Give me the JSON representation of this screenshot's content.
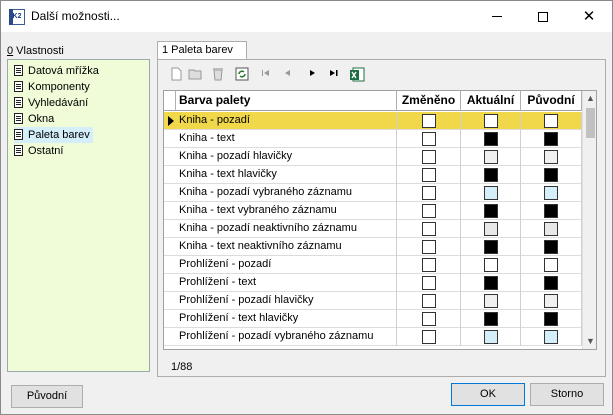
{
  "window": {
    "title": "Další možnosti...",
    "app_icon_text": "K2"
  },
  "left": {
    "label_prefix": "0",
    "label_rest": " Vlastnosti",
    "items": [
      {
        "label": "Datová mřížka",
        "selected": false
      },
      {
        "label": "Komponenty",
        "selected": false
      },
      {
        "label": "Vyhledávání",
        "selected": false
      },
      {
        "label": "Okna",
        "selected": false
      },
      {
        "label": "Paleta barev",
        "selected": true
      },
      {
        "label": "Ostatní",
        "selected": false
      }
    ]
  },
  "tab": {
    "label": "1 Paleta barev"
  },
  "toolbar": {
    "icons": [
      "new-icon",
      "open-icon",
      "delete-icon",
      "refresh-icon",
      "first-icon",
      "prev-icon",
      "next-icon",
      "last-icon",
      "excel-icon"
    ]
  },
  "grid": {
    "headers": {
      "name": "Barva palety",
      "changed": "Změněno",
      "current": "Aktuální",
      "original": "Původní"
    },
    "rows": [
      {
        "name": "Kniha - pozadí",
        "changed": "#ffffff",
        "current": "#ffffff",
        "original": "#ffffff",
        "current_row": true
      },
      {
        "name": "Kniha - text",
        "changed": "#ffffff",
        "current": "#000000",
        "original": "#000000"
      },
      {
        "name": "Kniha - pozadí hlavičky",
        "changed": "#ffffff",
        "current": "#f0f0f0",
        "original": "#f0f0f0"
      },
      {
        "name": "Kniha - text hlavičky",
        "changed": "#ffffff",
        "current": "#000000",
        "original": "#000000"
      },
      {
        "name": "Kniha - pozadí vybraného záznamu",
        "changed": "#ffffff",
        "current": "#d4eefa",
        "original": "#d4eefa"
      },
      {
        "name": "Kniha - text vybraného záznamu",
        "changed": "#ffffff",
        "current": "#000000",
        "original": "#000000"
      },
      {
        "name": "Kniha - pozadí neaktivního záznamu",
        "changed": "#ffffff",
        "current": "#e8e8e8",
        "original": "#e8e8e8"
      },
      {
        "name": "Kniha - text neaktivního záznamu",
        "changed": "#ffffff",
        "current": "#000000",
        "original": "#000000"
      },
      {
        "name": "Prohlížení - pozadí",
        "changed": "#ffffff",
        "current": "#ffffff",
        "original": "#ffffff"
      },
      {
        "name": "Prohlížení - text",
        "changed": "#ffffff",
        "current": "#000000",
        "original": "#000000"
      },
      {
        "name": "Prohlížení - pozadí hlavičky",
        "changed": "#ffffff",
        "current": "#f0f0f0",
        "original": "#f0f0f0"
      },
      {
        "name": "Prohlížení - text hlavičky",
        "changed": "#ffffff",
        "current": "#000000",
        "original": "#000000"
      },
      {
        "name": "Prohlížení - pozadí vybraného záznamu",
        "changed": "#ffffff",
        "current": "#d4eefa",
        "original": "#d4eefa"
      }
    ],
    "record_counter": "1/88"
  },
  "buttons": {
    "original": "Původní",
    "ok": "OK",
    "cancel": "Storno"
  },
  "colors": {
    "current_row": "#f0d84a",
    "left_panel_bg": "#f0fbd8",
    "selected_item": "#d4eefa"
  }
}
